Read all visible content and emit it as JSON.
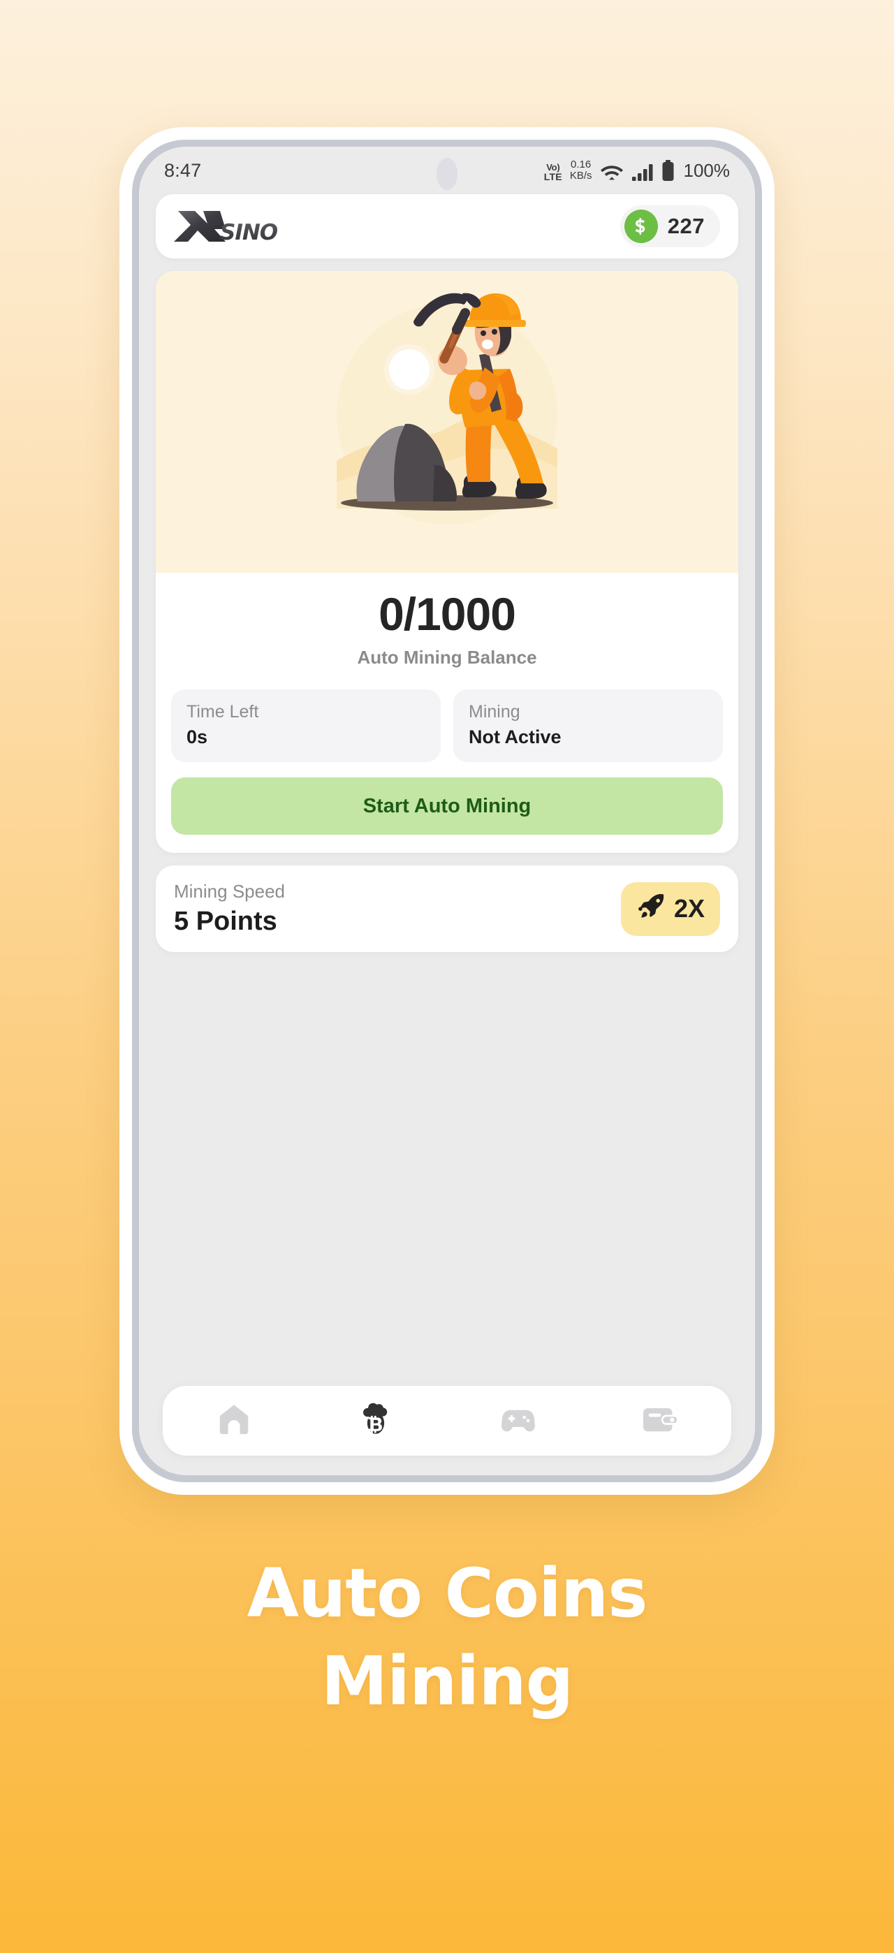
{
  "background": {
    "gradient_top": "#FDF0DC",
    "gradient_bottom": "#FBB839"
  },
  "status_bar": {
    "time": "8:47",
    "volte_line1": "Vo)",
    "volte_line2": "LTE",
    "net_speed_value": "0.16",
    "net_speed_unit": "KB/s",
    "wifi_icon": "wifi-icon",
    "signal_icon": "cellular-signal-icon",
    "battery_icon": "battery-full-icon",
    "battery_percent": "100%"
  },
  "app_bar": {
    "logo_mark": "X",
    "logo_text": "SINO",
    "coin_icon": "dollar-coin-icon",
    "coin_balance": "227",
    "coin_color": "#6CBE45"
  },
  "mining_card": {
    "illustration": "miner-with-pickaxe-illustration",
    "illustration_bg": "#FDF3DC",
    "balance_value": "0/1000",
    "balance_label": "Auto Mining Balance",
    "stats": [
      {
        "label": "Time Left",
        "value": "0s"
      },
      {
        "label": "Mining",
        "value": "Not Active"
      }
    ],
    "start_button": {
      "label": "Start Auto Mining",
      "bg": "#C3E6A4",
      "text_color": "#1E5C18"
    }
  },
  "speed_card": {
    "label": "Mining Speed",
    "value": "5 Points",
    "boost": {
      "icon": "rocket-icon",
      "label": "2X",
      "bg": "#FBE6A0"
    }
  },
  "bottom_nav": {
    "items": [
      {
        "name": "home-icon",
        "label": "Home",
        "active": false
      },
      {
        "name": "bitcoin-cloud-mining-icon",
        "label": "Mining",
        "active": true
      },
      {
        "name": "gamepad-icon",
        "label": "Games",
        "active": false
      },
      {
        "name": "wallet-icon",
        "label": "Wallet",
        "active": false
      }
    ],
    "active_color": "#333333",
    "inactive_color": "#d4d4d6"
  },
  "headline": {
    "line1": "Auto Coins",
    "line2": "Mining",
    "color": "#FFFFFF"
  }
}
